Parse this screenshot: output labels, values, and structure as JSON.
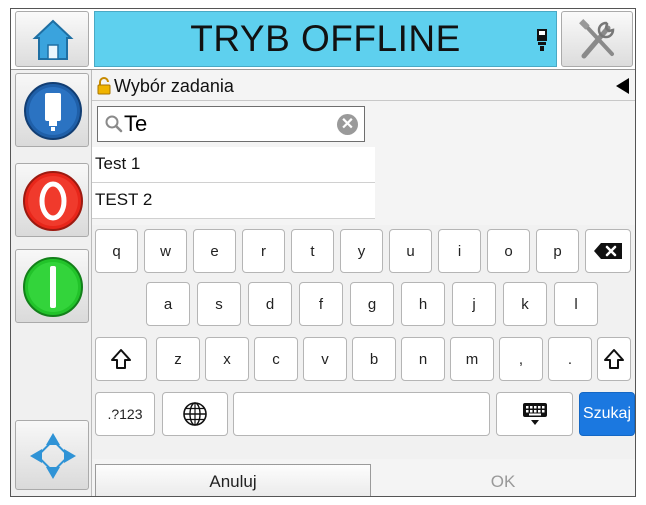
{
  "header": {
    "title": "TRYB OFFLINE"
  },
  "breadcrumb": {
    "label": "Wybór zadania"
  },
  "search": {
    "value": "Te"
  },
  "results": [
    {
      "label": "Test 1"
    },
    {
      "label": "TEST 2"
    }
  ],
  "keyboard": {
    "row1": [
      "q",
      "w",
      "e",
      "r",
      "t",
      "y",
      "u",
      "i",
      "o",
      "p"
    ],
    "row2": [
      "a",
      "s",
      "d",
      "f",
      "g",
      "h",
      "j",
      "k",
      "l"
    ],
    "row3": [
      "z",
      "x",
      "c",
      "v",
      "b",
      "n",
      "m",
      ",",
      "."
    ],
    "symbols_label": ".?123",
    "search_label": "Szukaj"
  },
  "footer": {
    "cancel_label": "Anuluj",
    "ok_label": "OK"
  },
  "colors": {
    "title_bg": "#5ed0ee",
    "accent": "#1b78e0",
    "stop": "#e8261a",
    "start": "#22c32a"
  }
}
